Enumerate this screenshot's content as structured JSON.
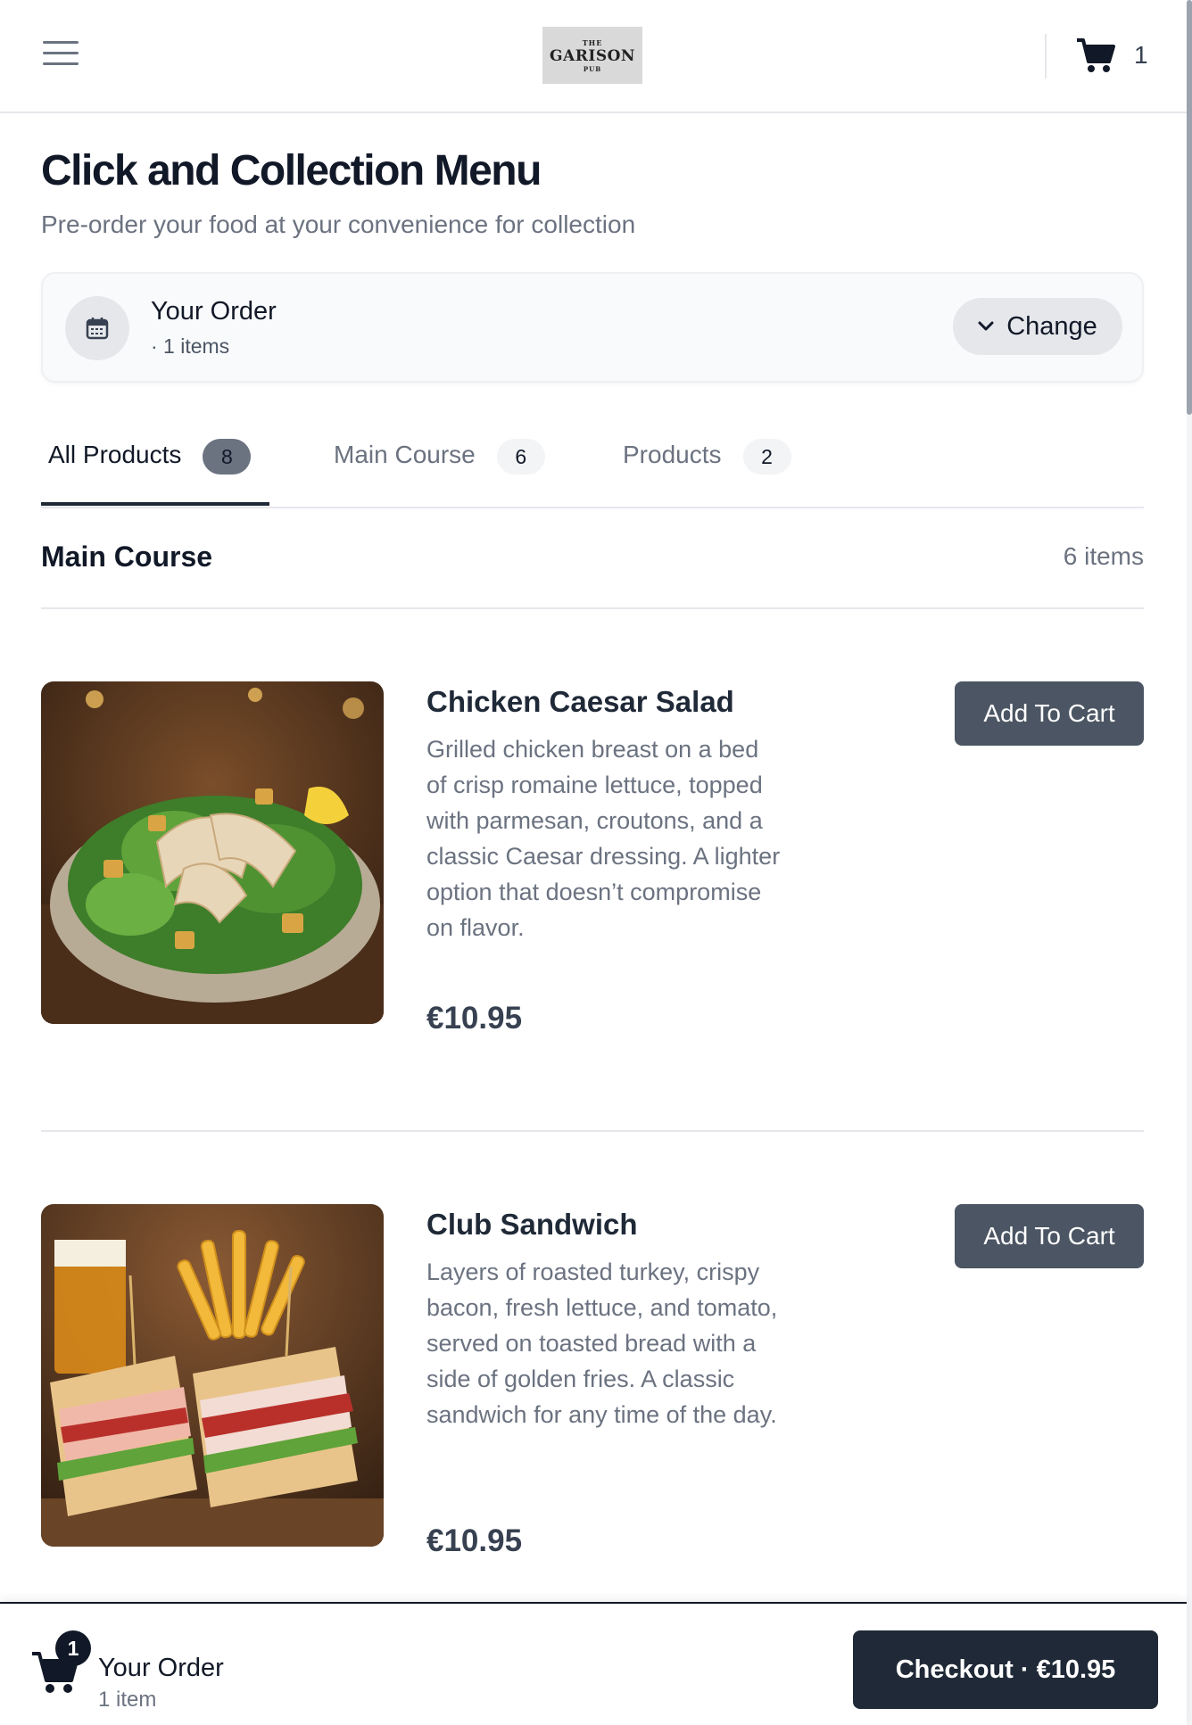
{
  "header": {
    "logo": {
      "line1": "THE",
      "line2": "GARISON",
      "line3": "PUB"
    },
    "cart_count": "1"
  },
  "page": {
    "title": "Click and Collection Menu",
    "subtitle": "Pre-order your food at your convenience for collection"
  },
  "order_card": {
    "title": "Your Order",
    "subtitle": "· 1 items",
    "change_label": "Change"
  },
  "tabs": [
    {
      "label": "All Products",
      "count": "8",
      "active": true
    },
    {
      "label": "Main Course",
      "count": "6",
      "active": false
    },
    {
      "label": "Products",
      "count": "2",
      "active": false
    }
  ],
  "section": {
    "title": "Main Course",
    "count": "6 items"
  },
  "products": [
    {
      "name": "Chicken Caesar Salad",
      "description": "Grilled chicken breast on a bed of crisp romaine lettuce, topped with parmesan, croutons, and a classic Caesar dressing. A lighter option that doesn’t compromise on flavor.",
      "price": "€10.95",
      "button": "Add To Cart"
    },
    {
      "name": "Club Sandwich",
      "description": "Layers of roasted turkey, crispy bacon, fresh lettuce, and tomato, served on toasted bread with a side of golden fries. A classic sandwich for any time of the day.",
      "price": "€10.95",
      "button": "Add To Cart"
    }
  ],
  "bottom_bar": {
    "badge": "1",
    "title": "Your Order",
    "subtitle": "1 item",
    "checkout_label": "Checkout · €10.95"
  },
  "icons": {
    "menu": "hamburger-icon",
    "cart": "cart-icon",
    "calendar": "calendar-icon",
    "chevron": "chevron-down-icon"
  },
  "colors": {
    "primary_dark": "#1f2937",
    "button": "#4b5563",
    "muted_text": "#6b7280",
    "border": "#e5e7eb"
  }
}
